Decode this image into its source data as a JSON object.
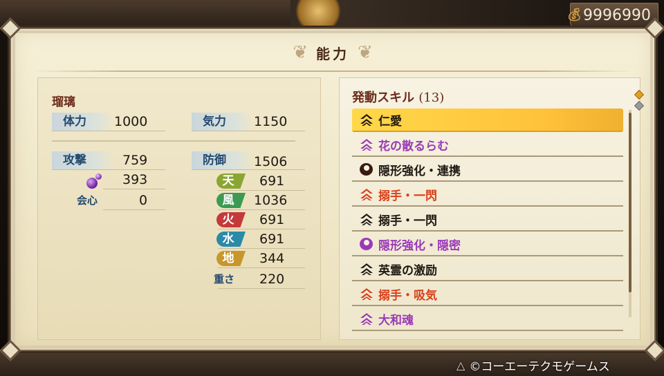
{
  "money": {
    "value": "9996990",
    "icon": "coin-icon"
  },
  "panel": {
    "title": "能力"
  },
  "character": {
    "name": "瑠璃"
  },
  "stats_left": {
    "hp_label": "体力",
    "hp_value": "1000",
    "attack_label": "攻撃",
    "attack_value": "759",
    "orb_value": "393",
    "crit_label": "会心",
    "crit_value": "0"
  },
  "stats_right": {
    "ki_label": "気力",
    "ki_value": "1150",
    "defense_label": "防御",
    "defense_value": "1506",
    "elements": [
      {
        "label": "天",
        "value": "691",
        "color": "#8aa632"
      },
      {
        "label": "風",
        "value": "1036",
        "color": "#3c9a52"
      },
      {
        "label": "火",
        "value": "691",
        "color": "#c43a3a"
      },
      {
        "label": "水",
        "value": "691",
        "color": "#2a8aa8"
      },
      {
        "label": "地",
        "value": "344",
        "color": "#c8962a"
      }
    ],
    "weight_label": "重さ",
    "weight_value": "220"
  },
  "skills": {
    "header": "発動スキル",
    "count": "(13)",
    "items": [
      {
        "label": "仁愛",
        "color": "#1f1812",
        "icon": "triple-chevron-icon",
        "selected": true
      },
      {
        "label": "花の散るらむ",
        "color": "#9a3ab8",
        "icon": "triple-chevron-icon"
      },
      {
        "label": "隠形強化・連携",
        "color": "#1f1812",
        "icon": "swirl-icon"
      },
      {
        "label": "搦手・一閃",
        "color": "#d8401a",
        "icon": "triple-chevron-icon"
      },
      {
        "label": "搦手・一閃",
        "color": "#1f1812",
        "icon": "triple-chevron-icon"
      },
      {
        "label": "隠形強化・隠密",
        "color": "#9a3ab8",
        "icon": "swirl-icon"
      },
      {
        "label": "英霊の激励",
        "color": "#1f1812",
        "icon": "triple-chevron-icon"
      },
      {
        "label": "搦手・吸気",
        "color": "#d8401a",
        "icon": "triple-chevron-icon"
      },
      {
        "label": "大和魂",
        "color": "#9a3ab8",
        "icon": "triple-chevron-icon"
      }
    ]
  },
  "footer": {
    "copyright": "©コーエーテクモゲームス",
    "button_icon": "triangle-button-icon"
  }
}
